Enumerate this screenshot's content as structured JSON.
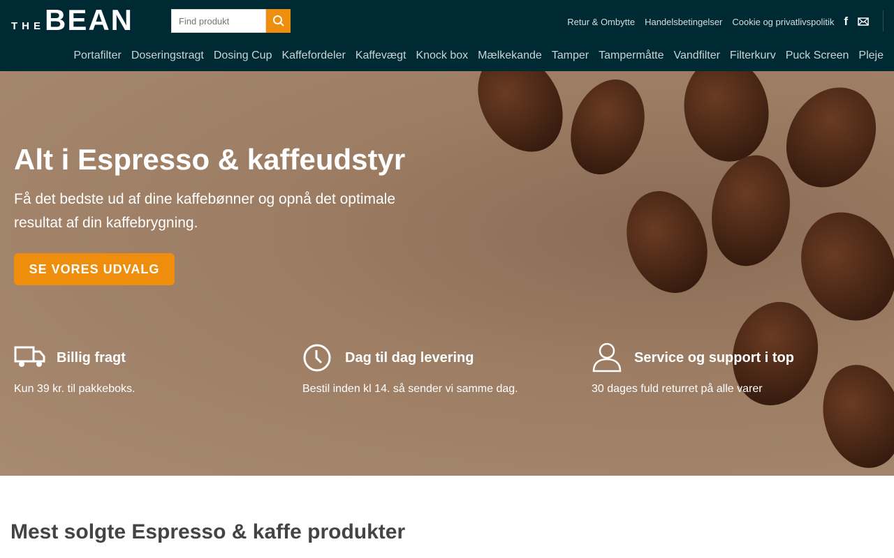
{
  "header": {
    "logo_small": "THE",
    "logo_big": "BEAN",
    "search_placeholder": "Find produkt",
    "top_links": [
      "Retur & Ombytte",
      "Handelsbetingelser",
      "Cookie og privatlivspolitik"
    ],
    "nav": [
      "Portafilter",
      "Doseringstragt",
      "Dosing Cup",
      "Kaffefordeler",
      "Kaffevægt",
      "Knock box",
      "Mælkekande",
      "Tamper",
      "Tampermåtte",
      "Vandfilter",
      "Filterkurv",
      "Puck Screen",
      "Pleje"
    ]
  },
  "hero": {
    "title": "Alt i Espresso & kaffeudstyr",
    "subtitle": "Få det bedste ud af dine kaffebønner og opnå det optimale resultat af din kaffebrygning.",
    "cta": "SE VORES UDVALG",
    "features": [
      {
        "icon": "truck-icon",
        "title": "Billig fragt",
        "desc": "Kun 39 kr. til pakkeboks."
      },
      {
        "icon": "clock-icon",
        "title": "Dag til dag levering",
        "desc": "Bestil inden kl 14. så sender vi samme dag."
      },
      {
        "icon": "user-icon",
        "title": "Service og support i top",
        "desc": "30 dages fuld returret på alle varer"
      }
    ]
  },
  "section": {
    "title": "Mest solgte Espresso & kaffe produkter"
  },
  "colors": {
    "header": "#002a33",
    "accent": "#ee8e0c"
  }
}
